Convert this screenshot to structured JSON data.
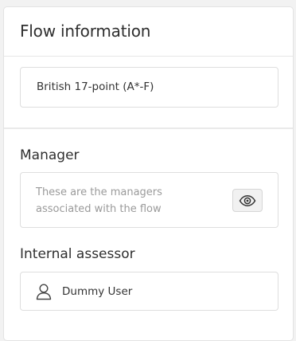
{
  "panel": {
    "title": "Flow information"
  },
  "grade": {
    "scale": "British 17-point (A*-F)"
  },
  "manager": {
    "label": "Manager",
    "description": "These are the managers associated with the flow",
    "view_icon": "eye-icon"
  },
  "assessor": {
    "label": "Internal assessor",
    "user_icon": "user-icon",
    "name": "Dummy User"
  }
}
